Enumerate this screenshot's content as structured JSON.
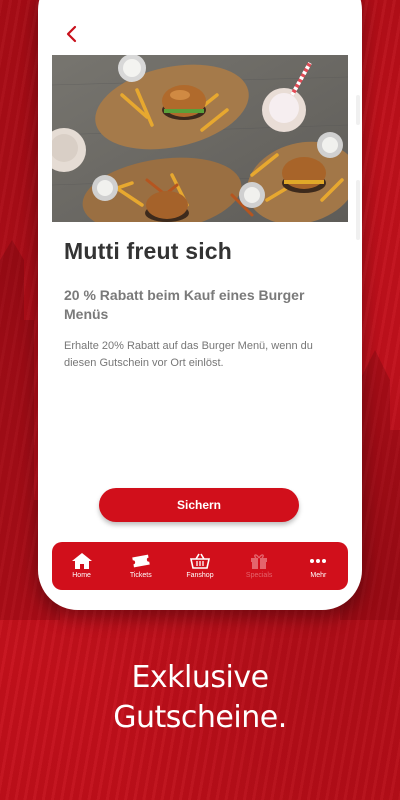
{
  "detail": {
    "title": "Mutti freut sich",
    "subtitle": "20 % Rabatt beim Kauf eines Burger Menüs",
    "description": "Erhalte 20% Rabatt auf das Burger Menü, wenn du diesen Gutschein vor Ort einlöst.",
    "cta_label": "Sichern",
    "back_icon": "chevron-left-icon"
  },
  "nav": {
    "items": [
      {
        "label": "Home",
        "icon": "home-icon",
        "active": true
      },
      {
        "label": "Tickets",
        "icon": "ticket-icon",
        "active": true
      },
      {
        "label": "Fanshop",
        "icon": "basket-icon",
        "active": true
      },
      {
        "label": "Specials",
        "icon": "gift-icon",
        "active": false
      },
      {
        "label": "Mehr",
        "icon": "more-dots-icon",
        "active": true
      }
    ]
  },
  "promo": {
    "line1": "Exklusive",
    "line2": "Gutscheine."
  },
  "colors": {
    "brand_red": "#d10f1b",
    "background_red": "#c8101b",
    "title_text": "#333333",
    "inactive_nav": "#e4646c"
  }
}
